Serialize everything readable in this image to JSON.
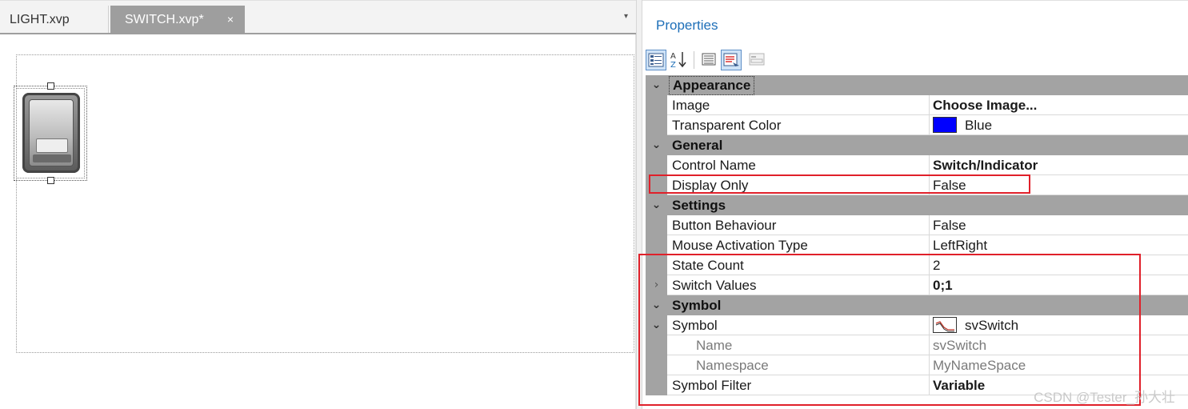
{
  "tabs": [
    {
      "label": "LIGHT.xvp",
      "active": false
    },
    {
      "label": "SWITCH.xvp*",
      "active": true,
      "close_glyph": "×"
    }
  ],
  "tab_dropdown_glyph": "▾",
  "canvas": {
    "control": {
      "icon": "toggle-switch-icon"
    }
  },
  "properties": {
    "title": "Properties",
    "toolbar": {
      "categorized_icon": "categorized-icon",
      "alphabetical_icon": "sort-az-icon",
      "properties_icon": "property-list-icon",
      "events_icon": "events-icon",
      "pages_icon": "property-pages-icon"
    },
    "categories": [
      {
        "name": "Appearance",
        "expanded": true,
        "props": [
          {
            "name": "Image",
            "value": "Choose Image...",
            "bold": true
          },
          {
            "name": "Transparent Color",
            "value": "Blue",
            "swatch": "#0000ff"
          }
        ]
      },
      {
        "name": "General",
        "expanded": true,
        "props": [
          {
            "name": "Control Name",
            "value": "Switch/Indicator",
            "bold": true
          },
          {
            "name": "Display Only",
            "value": "False"
          }
        ]
      },
      {
        "name": "Settings",
        "expanded": true,
        "props": [
          {
            "name": "Button Behaviour",
            "value": "False"
          },
          {
            "name": "Mouse Activation Type",
            "value": "LeftRight"
          },
          {
            "name": "State Count",
            "value": "2"
          },
          {
            "name": "Switch Values",
            "value": "0;1",
            "bold": true,
            "collapsed": true
          }
        ]
      },
      {
        "name": "Symbol",
        "expanded": true,
        "props": [
          {
            "name": "Symbol",
            "value": "svSwitch",
            "expanded": true,
            "icon": "signal-icon"
          },
          {
            "name": "Name",
            "value": "svSwitch",
            "sub": true
          },
          {
            "name": "Namespace",
            "value": "MyNameSpace",
            "sub": true
          },
          {
            "name": "Symbol Filter",
            "value": "Variable",
            "bold": true
          }
        ]
      }
    ]
  },
  "colors": {
    "accent_title": "#1e6fb8",
    "category_bar": "#a3a3a3",
    "highlight_red": "#e0202a",
    "swatch_blue": "#0000ff"
  },
  "watermark": "CSDN @Tester_孙大壮"
}
